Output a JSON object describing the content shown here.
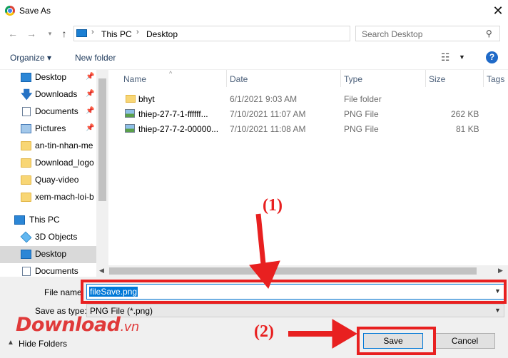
{
  "window": {
    "title": "Save As",
    "close_glyph": "✕"
  },
  "address": {
    "crumbs": [
      "This PC",
      "Desktop"
    ],
    "search_placeholder": "Search Desktop"
  },
  "toolbar": {
    "organize": "Organize ▾",
    "new_folder": "New folder"
  },
  "sidebar": {
    "items": [
      {
        "label": "Desktop",
        "icon": "desktop-icon",
        "pinned": true
      },
      {
        "label": "Downloads",
        "icon": "download-icon",
        "pinned": true
      },
      {
        "label": "Documents",
        "icon": "document-icon",
        "pinned": true
      },
      {
        "label": "Pictures",
        "icon": "pictures-icon",
        "pinned": true
      },
      {
        "label": "an-tin-nhan-me",
        "icon": "folder-icon"
      },
      {
        "label": "Download_logo",
        "icon": "folder-icon"
      },
      {
        "label": "Quay-video",
        "icon": "folder-icon"
      },
      {
        "label": "xem-mach-loi-b",
        "icon": "folder-icon"
      },
      {
        "label": "This PC",
        "icon": "pc-icon"
      },
      {
        "label": "3D Objects",
        "icon": "3d-objects-icon"
      },
      {
        "label": "Desktop",
        "icon": "desktop-icon",
        "selected": true
      },
      {
        "label": "Documents",
        "icon": "document-icon"
      }
    ]
  },
  "columns": [
    "Name",
    "Date",
    "Type",
    "Size",
    "Tags"
  ],
  "files": [
    {
      "name": "bhyt",
      "date": "6/1/2021 9:03 AM",
      "type": "File folder",
      "size": "",
      "icon": "folder-icon"
    },
    {
      "name": "thiep-27-7-1-ffffff...",
      "date": "7/10/2021 11:07 AM",
      "type": "PNG File",
      "size": "262 KB",
      "icon": "image-file-icon"
    },
    {
      "name": "thiep-27-7-2-00000...",
      "date": "7/10/2021 11:08 AM",
      "type": "PNG File",
      "size": "81 KB",
      "icon": "image-file-icon"
    }
  ],
  "form": {
    "file_name_label": "File name:",
    "file_name_value": "fileSave.png",
    "save_type_label": "Save as type:",
    "save_type_value": "PNG File (*.png)"
  },
  "footer": {
    "hide_folders": "Hide Folders",
    "save": "Save",
    "cancel": "Cancel"
  },
  "annotations": {
    "step1": "(1)",
    "step2": "(2)",
    "color": "#e82020"
  },
  "watermark": {
    "main": "Download",
    "suffix": ".vn",
    "color": "#e03a3a"
  }
}
